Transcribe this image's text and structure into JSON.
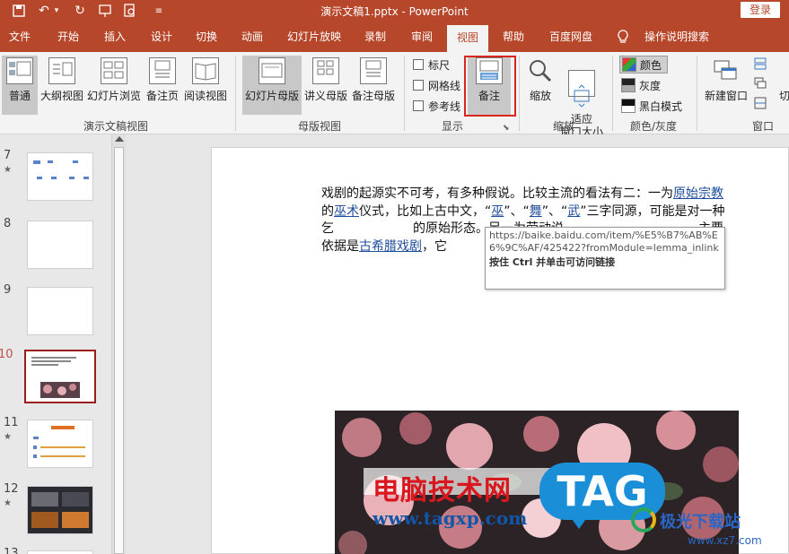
{
  "app": {
    "title": "演示文稿1.pptx  -  PowerPoint",
    "login_label": "登录",
    "quick_access": [
      "save-icon",
      "undo-icon",
      "undo-dropdown-icon",
      "redo-icon",
      "present-icon",
      "preview-icon",
      "customize-icon"
    ]
  },
  "tabs": [
    {
      "label": "文件"
    },
    {
      "label": "开始"
    },
    {
      "label": "插入"
    },
    {
      "label": "设计"
    },
    {
      "label": "切换"
    },
    {
      "label": "动画"
    },
    {
      "label": "幻灯片放映"
    },
    {
      "label": "录制"
    },
    {
      "label": "审阅"
    },
    {
      "label": "视图",
      "active": true
    },
    {
      "label": "帮助"
    },
    {
      "label": "百度网盘"
    },
    {
      "label": "操作说明搜索"
    }
  ],
  "ribbon": {
    "presentation_views": {
      "group_label": "演示文稿视图",
      "buttons": [
        "普通",
        "大纲视图",
        "幻灯片浏览",
        "备注页",
        "阅读视图"
      ]
    },
    "master_views": {
      "group_label": "母版视图",
      "buttons": [
        "幻灯片母版",
        "讲义母版",
        "备注母版"
      ]
    },
    "show": {
      "group_label": "显示",
      "checkboxes": [
        "标尺",
        "网格线",
        "参考线"
      ],
      "notes_button": "备注"
    },
    "zoom": {
      "group_label": "缩放",
      "zoom_button": "缩放",
      "fit_button": "适应\n窗口大小"
    },
    "color": {
      "group_label": "颜色/灰度",
      "items": [
        "颜色",
        "灰度",
        "黑白模式"
      ]
    },
    "window": {
      "group_label": "窗口",
      "new_window": "新建窗口",
      "cut_off": "切"
    }
  },
  "slides": [
    {
      "num": "7",
      "star": "★"
    },
    {
      "num": "8",
      "star": ""
    },
    {
      "num": "9",
      "star": ""
    },
    {
      "num": "10",
      "star": ""
    },
    {
      "num": "11",
      "star": "★"
    },
    {
      "num": "12",
      "star": "★"
    },
    {
      "num": "13",
      "star": ""
    }
  ],
  "notes": {
    "p1": "戏剧的起源实不可考，有多种假说。比较主流的看法有二：一为",
    "link1": "原始宗教",
    "p2": "的",
    "link2": "巫术",
    "p3": "仪式，比如上古中文，“",
    "link3": "巫",
    "p4": "”、“",
    "link4": "舞",
    "p5": "”、“",
    "link5": "武",
    "p6": "”三字同源，可能是对一种乞",
    "p7": "的原始形态。另一为劳动说",
    "p8": "主要依据是",
    "link6": "古希腊戏剧",
    "p9": "，它"
  },
  "tooltip": {
    "url": "https://baike.baidu.com/item/%E5%B7%AB%E6%9C%AF/425422?fromModule=lemma_inlink",
    "hint": "按住 Ctrl 并单击可访问链接"
  },
  "watermark": {
    "site_cn": "电脑技术网",
    "site_url": "www.tagxp.com",
    "badge": "TAG",
    "corner_cn": "极光下载站",
    "corner_url": "www.xz7.com"
  }
}
